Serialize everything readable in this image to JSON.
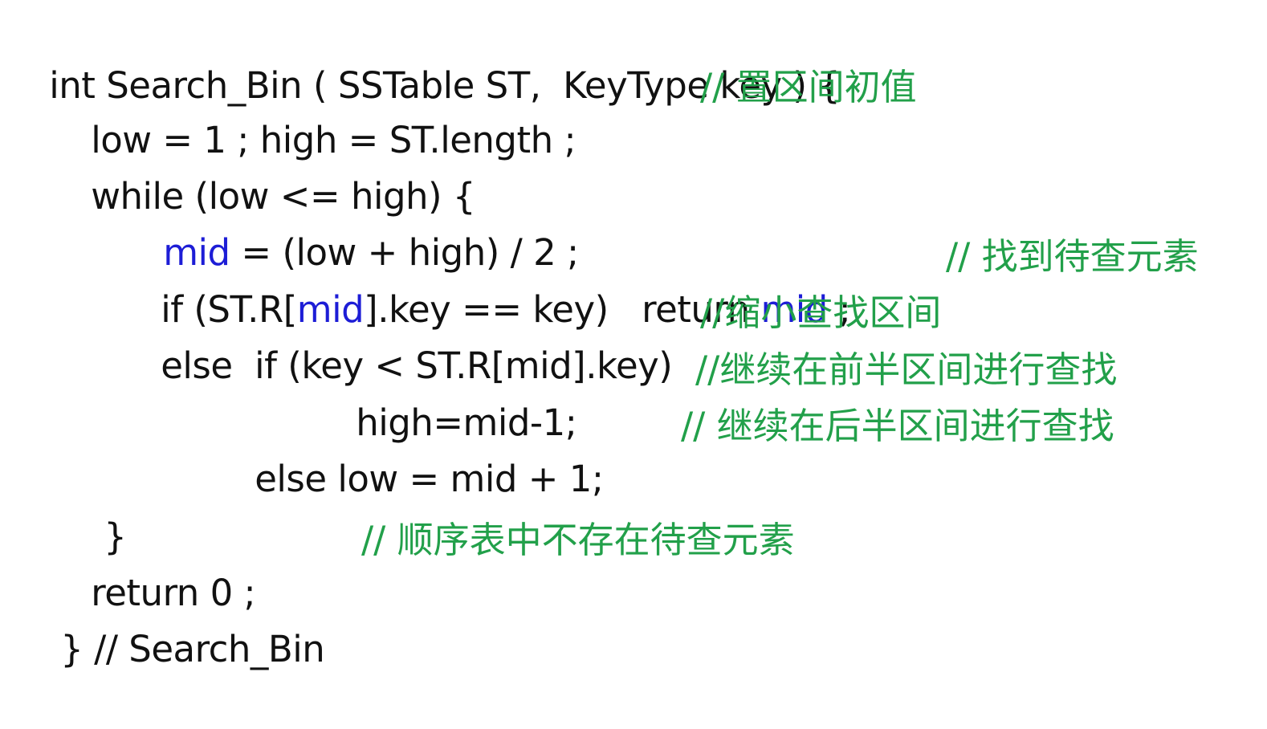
{
  "colors": {
    "code": "#111111",
    "comment": "#22a04a",
    "highlight": "#1d1dd6",
    "background": "#ffffff"
  },
  "lines": {
    "l1": {
      "code": "int Search_Bin ( SSTable ST,  KeyType key ) {"
    },
    "l2": {
      "code": "low = 1 ; high = ST.length ;",
      "comment": "// 置区间初值"
    },
    "l3": {
      "code": "while (low <= high) {"
    },
    "l4": {
      "mid": "mid",
      "rest": " = (low + high) / 2 ;"
    },
    "l5": {
      "a": "if (ST.R[",
      "mid1": "mid",
      "b": "].key == key)   return ",
      "mid2": "mid",
      "c": " ;",
      "comment": "// 找到待查元素"
    },
    "l6": {
      "code": "else  if (key < ST.R[mid].key)",
      "comment": "//缩小查找区间"
    },
    "l7": {
      "code": "high=mid-1;",
      "comment": "//继续在前半区间进行查找"
    },
    "l8": {
      "code": "else low = mid + 1;",
      "comment": "// 继续在后半区间进行查找"
    },
    "l9": {
      "code": "}"
    },
    "l10": {
      "code": "return 0 ;",
      "comment": "// 顺序表中不存在待查元素"
    },
    "l11": {
      "code": "} // Search_Bin"
    }
  }
}
